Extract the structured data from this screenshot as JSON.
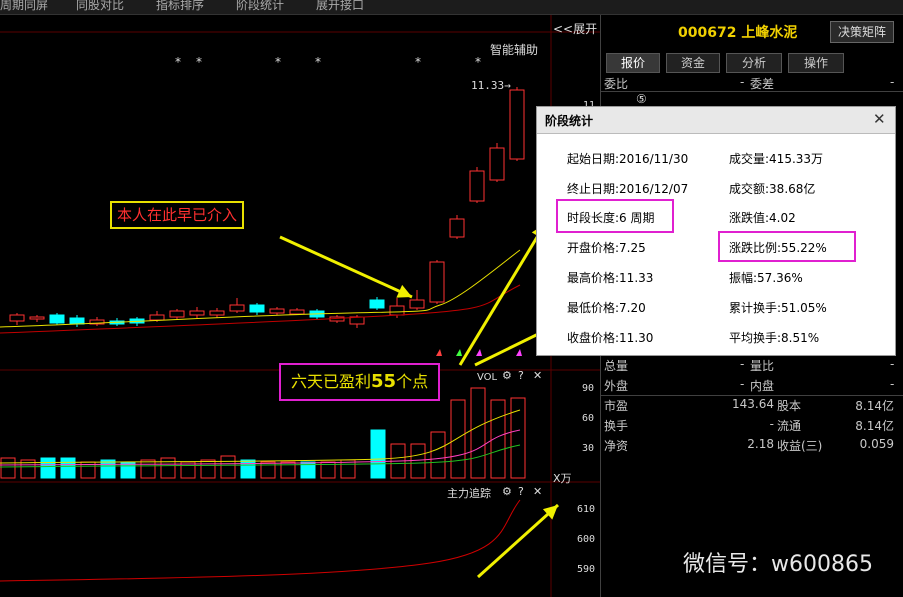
{
  "menu": {
    "items": [
      "周期同屏",
      "同股对比",
      "指标排序",
      "阶段统计",
      "展开接口"
    ]
  },
  "chart": {
    "expand_label": "<<展开",
    "indicator_label": "智能辅助",
    "price_marker": "11.33→",
    "price_tick_top": "11",
    "vol_label": "VOL",
    "vol_axis": [
      "90",
      "60",
      "30"
    ],
    "vol_unit": "X万",
    "main_force_label": "主力追踪",
    "main_force_axis": [
      "610",
      "600",
      "590"
    ],
    "star_symbol": "*"
  },
  "stock": {
    "code": "000672",
    "name": "上峰水泥",
    "decision_button": "决策矩阵"
  },
  "tabs": [
    "报价",
    "资金",
    "分析",
    "操作"
  ],
  "quote": {
    "weibi_label": "委比",
    "weicha_label": "委差",
    "weibi_dash": "-",
    "weicha_dash": "-",
    "level_marker": "⑤",
    "zongliang": "总量",
    "liangbi": "量比",
    "waipan": "外盘",
    "neipan": "内盘",
    "rows": [
      {
        "l1": "市盈",
        "v1": "143.64",
        "l2": "股本",
        "v2": "8.14亿"
      },
      {
        "l1": "换手",
        "v1": "-",
        "l2": "流通",
        "v2": "8.14亿"
      },
      {
        "l1": "净资",
        "v1": "2.18",
        "l2": "收益(三)",
        "v2": "0.059"
      }
    ]
  },
  "dialog": {
    "title": "阶段统计",
    "close": "✕",
    "left": [
      "起始日期:2016/11/30",
      "终止日期:2016/12/07",
      "时段长度:6 周期",
      "开盘价格:7.25",
      "最高价格:11.33",
      "最低价格:7.20",
      "收盘价格:11.30"
    ],
    "right": [
      "成交量:415.33万",
      "成交额:38.68亿",
      "涨跌值:4.02",
      "涨跌比例:55.22%",
      "振幅:57.36%",
      "累计换手:51.05%",
      "平均换手:8.51%"
    ]
  },
  "annotations": {
    "note1": "本人在此早已介入",
    "note2_prefix": "六天已盈利",
    "note2_num": "55",
    "note2_suffix": "个点"
  },
  "watermark": "微信号：w600865",
  "colors": {
    "up": "#ff3232",
    "down": "#00ffff",
    "ma_yellow": "#e8e000",
    "ma_red": "#c00000",
    "ma_green": "#20c020",
    "ma_pink": "#ff40c0"
  }
}
